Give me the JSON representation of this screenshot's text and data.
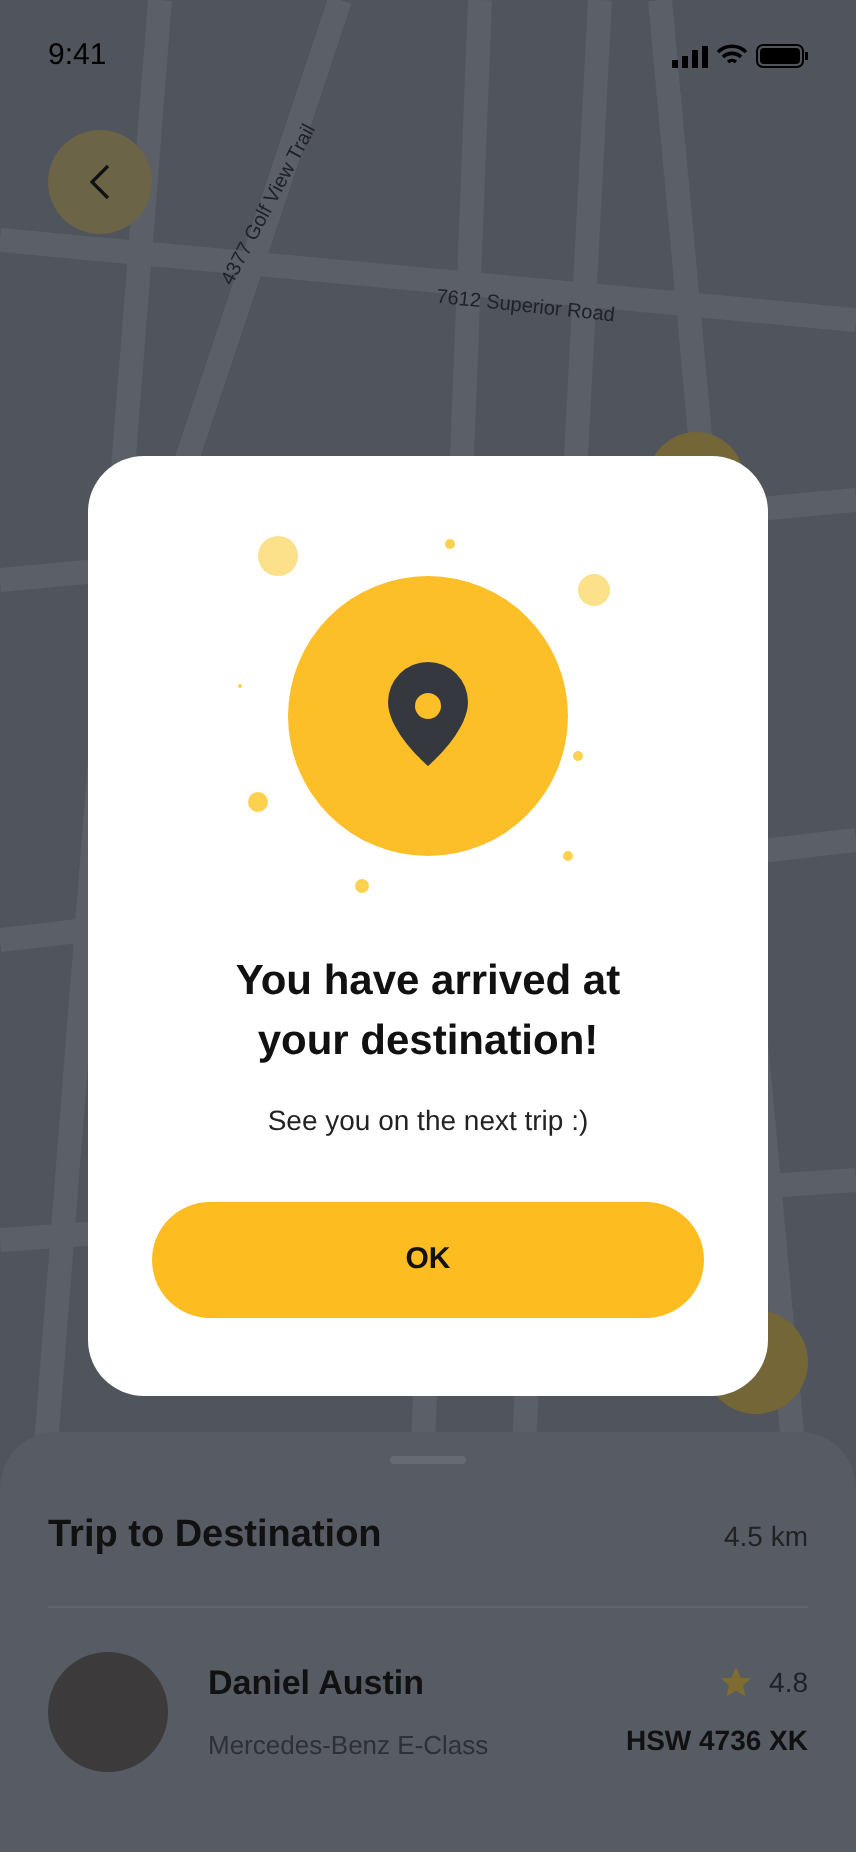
{
  "status_bar": {
    "time": "9:41"
  },
  "map": {
    "streets": [
      {
        "name": "4377 Golf View Trail",
        "kind": "diagonal"
      },
      {
        "name": "7612 Superior Road",
        "kind": "slanted"
      }
    ]
  },
  "dialog": {
    "title": "You have arrived at your destination!",
    "message": "See you on the next trip :)",
    "button": "OK"
  },
  "trip": {
    "title": "Trip to Destination",
    "distance": "4.5 km"
  },
  "driver": {
    "name": "Daniel Austin",
    "car": "Mercedes-Benz E-Class",
    "rating": "4.8",
    "plate": "HSW 4736 XK"
  }
}
